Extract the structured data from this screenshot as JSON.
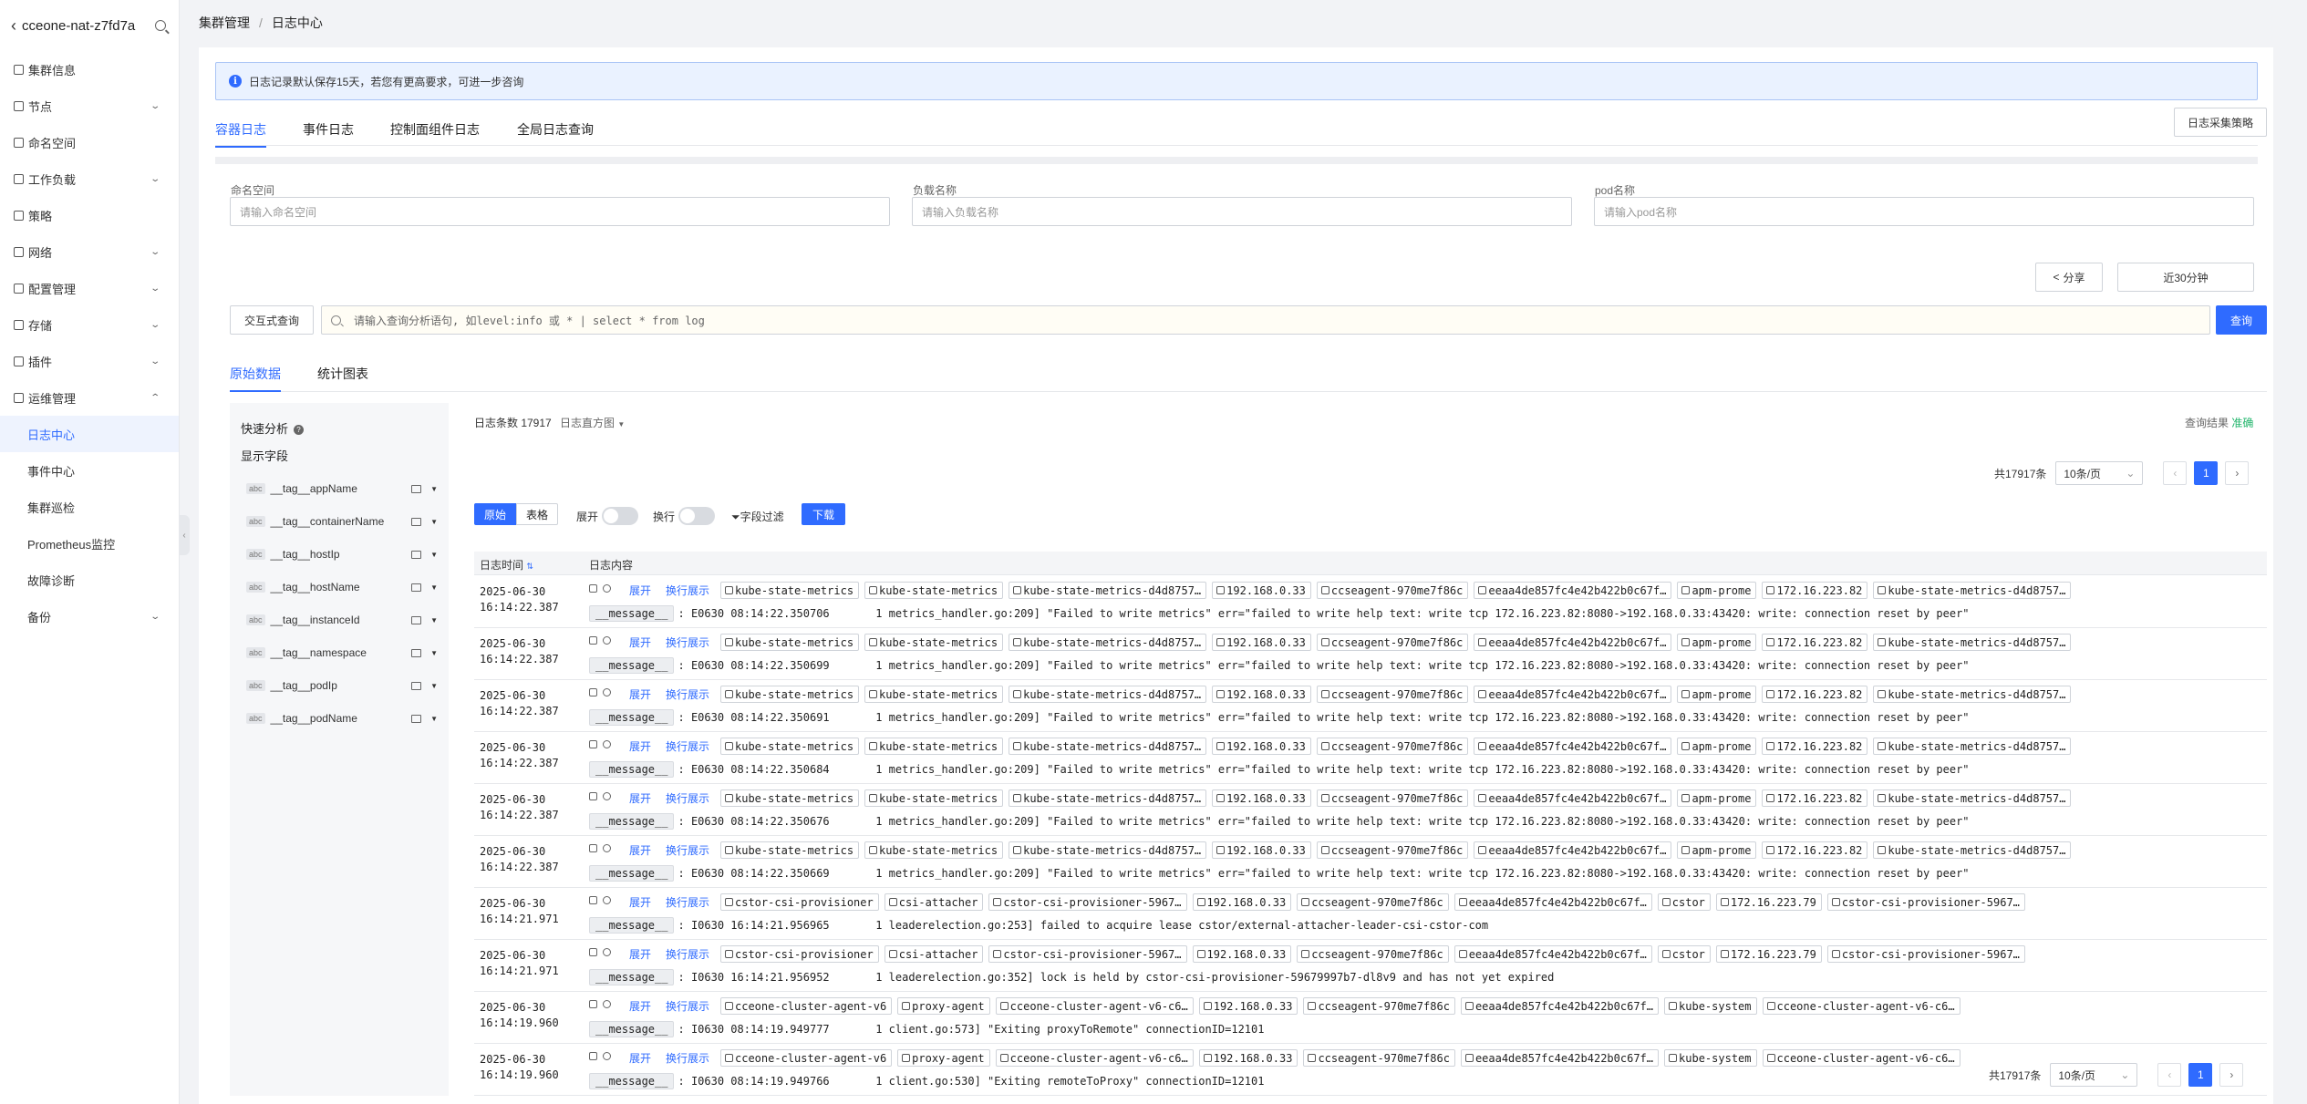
{
  "sidebar": {
    "cluster_name": "cceone-nat-z7fd7a",
    "items": [
      {
        "label": "集群信息",
        "chevron": ""
      },
      {
        "label": "节点",
        "chevron": "⌄"
      },
      {
        "label": "命名空间",
        "chevron": ""
      },
      {
        "label": "工作负载",
        "chevron": "⌄"
      },
      {
        "label": "策略",
        "chevron": ""
      },
      {
        "label": "网络",
        "chevron": "⌄"
      },
      {
        "label": "配置管理",
        "chevron": "⌄"
      },
      {
        "label": "存储",
        "chevron": "⌄"
      },
      {
        "label": "插件",
        "chevron": "⌄"
      },
      {
        "label": "运维管理",
        "chevron": "⌃"
      }
    ],
    "sub_items": [
      "日志中心",
      "事件中心",
      "集群巡检",
      "Prometheus监控",
      "故障诊断"
    ],
    "backup": {
      "label": "备份",
      "chevron": "⌄"
    }
  },
  "breadcrumb": {
    "parent": "集群管理",
    "sep": "/",
    "current": "日志中心"
  },
  "notice": {
    "text": "日志记录默认保存15天，若您有更高要求，可进一步咨询"
  },
  "tabs": [
    "容器日志",
    "事件日志",
    "控制面组件日志",
    "全局日志查询"
  ],
  "collect_policy": "日志采集策略",
  "filters": {
    "namespace": {
      "label": "命名空间",
      "placeholder": "请输入命名空间"
    },
    "workload": {
      "label": "负载名称",
      "placeholder": "请输入负载名称"
    },
    "pod": {
      "label": "pod名称",
      "placeholder": "请输入pod名称"
    }
  },
  "share_label": "分享",
  "time_range": "近30分钟",
  "interactive_query": "交互式查询",
  "query_placeholder": "请输入查询分析语句, 如level:info 或 * | select * from log",
  "query_button": "查询",
  "subtabs": [
    "原始数据",
    "统计图表"
  ],
  "left_panel": {
    "quick_analysis": "快速分析",
    "display_fields": "显示字段",
    "fields": [
      "__tag__appName",
      "__tag__containerName",
      "__tag__hostIp",
      "__tag__hostName",
      "__tag__instanceId",
      "__tag__namespace",
      "__tag__podIp",
      "__tag__podName"
    ]
  },
  "results": {
    "count_text": "日志条数 17917",
    "histogram": "日志直方图",
    "status_label": "查询结果",
    "status_value": "准确",
    "status_color": "#21b56b",
    "view_raw": "原始",
    "view_table": "表格",
    "expand": "展开",
    "wrap": "换行",
    "field_filter": "字段过滤",
    "download": "下载",
    "col_time": "日志时间",
    "col_content": "日志内容",
    "row_expand": "展开",
    "row_wrap": "换行展示"
  },
  "pagination": {
    "total": "共17917条",
    "page_size": "10条/页",
    "current": "1"
  },
  "log_rows": [
    {
      "date": "2025-06-30",
      "time": "16:14:22.387",
      "tags": [
        "kube-state-metrics",
        "kube-state-metrics",
        "kube-state-metrics-d4d8757…",
        "192.168.0.33",
        "ccseagent-970me7f86c",
        "eeaa4de857fc4e42b422b0c67f…",
        "apm-prome",
        "172.16.223.82",
        "kube-state-metrics-d4d8757…"
      ],
      "message": "E0630 08:14:22.350706       1 metrics_handler.go:209] \"Failed to write metrics\" err=\"failed to write help text: write tcp 172.16.223.82:8080->192.168.0.33:43420: write: connection reset by peer\""
    },
    {
      "date": "2025-06-30",
      "time": "16:14:22.387",
      "tags": [
        "kube-state-metrics",
        "kube-state-metrics",
        "kube-state-metrics-d4d8757…",
        "192.168.0.33",
        "ccseagent-970me7f86c",
        "eeaa4de857fc4e42b422b0c67f…",
        "apm-prome",
        "172.16.223.82",
        "kube-state-metrics-d4d8757…"
      ],
      "message": "E0630 08:14:22.350699       1 metrics_handler.go:209] \"Failed to write metrics\" err=\"failed to write help text: write tcp 172.16.223.82:8080->192.168.0.33:43420: write: connection reset by peer\""
    },
    {
      "date": "2025-06-30",
      "time": "16:14:22.387",
      "tags": [
        "kube-state-metrics",
        "kube-state-metrics",
        "kube-state-metrics-d4d8757…",
        "192.168.0.33",
        "ccseagent-970me7f86c",
        "eeaa4de857fc4e42b422b0c67f…",
        "apm-prome",
        "172.16.223.82",
        "kube-state-metrics-d4d8757…"
      ],
      "message": "E0630 08:14:22.350691       1 metrics_handler.go:209] \"Failed to write metrics\" err=\"failed to write help text: write tcp 172.16.223.82:8080->192.168.0.33:43420: write: connection reset by peer\""
    },
    {
      "date": "2025-06-30",
      "time": "16:14:22.387",
      "tags": [
        "kube-state-metrics",
        "kube-state-metrics",
        "kube-state-metrics-d4d8757…",
        "192.168.0.33",
        "ccseagent-970me7f86c",
        "eeaa4de857fc4e42b422b0c67f…",
        "apm-prome",
        "172.16.223.82",
        "kube-state-metrics-d4d8757…"
      ],
      "message": "E0630 08:14:22.350684       1 metrics_handler.go:209] \"Failed to write metrics\" err=\"failed to write help text: write tcp 172.16.223.82:8080->192.168.0.33:43420: write: connection reset by peer\""
    },
    {
      "date": "2025-06-30",
      "time": "16:14:22.387",
      "tags": [
        "kube-state-metrics",
        "kube-state-metrics",
        "kube-state-metrics-d4d8757…",
        "192.168.0.33",
        "ccseagent-970me7f86c",
        "eeaa4de857fc4e42b422b0c67f…",
        "apm-prome",
        "172.16.223.82",
        "kube-state-metrics-d4d8757…"
      ],
      "message": "E0630 08:14:22.350676       1 metrics_handler.go:209] \"Failed to write metrics\" err=\"failed to write help text: write tcp 172.16.223.82:8080->192.168.0.33:43420: write: connection reset by peer\""
    },
    {
      "date": "2025-06-30",
      "time": "16:14:22.387",
      "tags": [
        "kube-state-metrics",
        "kube-state-metrics",
        "kube-state-metrics-d4d8757…",
        "192.168.0.33",
        "ccseagent-970me7f86c",
        "eeaa4de857fc4e42b422b0c67f…",
        "apm-prome",
        "172.16.223.82",
        "kube-state-metrics-d4d8757…"
      ],
      "message": "E0630 08:14:22.350669       1 metrics_handler.go:209] \"Failed to write metrics\" err=\"failed to write help text: write tcp 172.16.223.82:8080->192.168.0.33:43420: write: connection reset by peer\""
    },
    {
      "date": "2025-06-30",
      "time": "16:14:21.971",
      "tags": [
        "cstor-csi-provisioner",
        "csi-attacher",
        "cstor-csi-provisioner-5967…",
        "192.168.0.33",
        "ccseagent-970me7f86c",
        "eeaa4de857fc4e42b422b0c67f…",
        "cstor",
        "172.16.223.79",
        "cstor-csi-provisioner-5967…"
      ],
      "message": "I0630 16:14:21.956965       1 leaderelection.go:253] failed to acquire lease cstor/external-attacher-leader-csi-cstor-com"
    },
    {
      "date": "2025-06-30",
      "time": "16:14:21.971",
      "tags": [
        "cstor-csi-provisioner",
        "csi-attacher",
        "cstor-csi-provisioner-5967…",
        "192.168.0.33",
        "ccseagent-970me7f86c",
        "eeaa4de857fc4e42b422b0c67f…",
        "cstor",
        "172.16.223.79",
        "cstor-csi-provisioner-5967…"
      ],
      "message": "I0630 16:14:21.956952       1 leaderelection.go:352] lock is held by cstor-csi-provisioner-59679997b7-dl8v9 and has not yet expired"
    },
    {
      "date": "2025-06-30",
      "time": "16:14:19.960",
      "tags": [
        "cceone-cluster-agent-v6",
        "proxy-agent",
        "cceone-cluster-agent-v6-c6…",
        "192.168.0.33",
        "ccseagent-970me7f86c",
        "eeaa4de857fc4e42b422b0c67f…",
        "kube-system",
        "cceone-cluster-agent-v6-c6…"
      ],
      "message": "I0630 08:14:19.949777       1 client.go:573] \"Exiting proxyToRemote\" connectionID=12101"
    },
    {
      "date": "2025-06-30",
      "time": "16:14:19.960",
      "tags": [
        "cceone-cluster-agent-v6",
        "proxy-agent",
        "cceone-cluster-agent-v6-c6…",
        "192.168.0.33",
        "ccseagent-970me7f86c",
        "eeaa4de857fc4e42b422b0c67f…",
        "kube-system",
        "cceone-cluster-agent-v6-c6…"
      ],
      "message": "I0630 08:14:19.949766       1 client.go:530] \"Exiting remoteToProxy\" connectionID=12101"
    }
  ],
  "icons": {
    "back": "chevron-left-icon",
    "search": "search-icon",
    "info": "info-icon",
    "share": "share-icon",
    "filter": "filter-icon",
    "sort": "sort-icon",
    "copy": "copy-icon",
    "inspect": "magnify-icon"
  },
  "colors": {
    "accent": "#2f6bff",
    "success": "#21b56b"
  }
}
